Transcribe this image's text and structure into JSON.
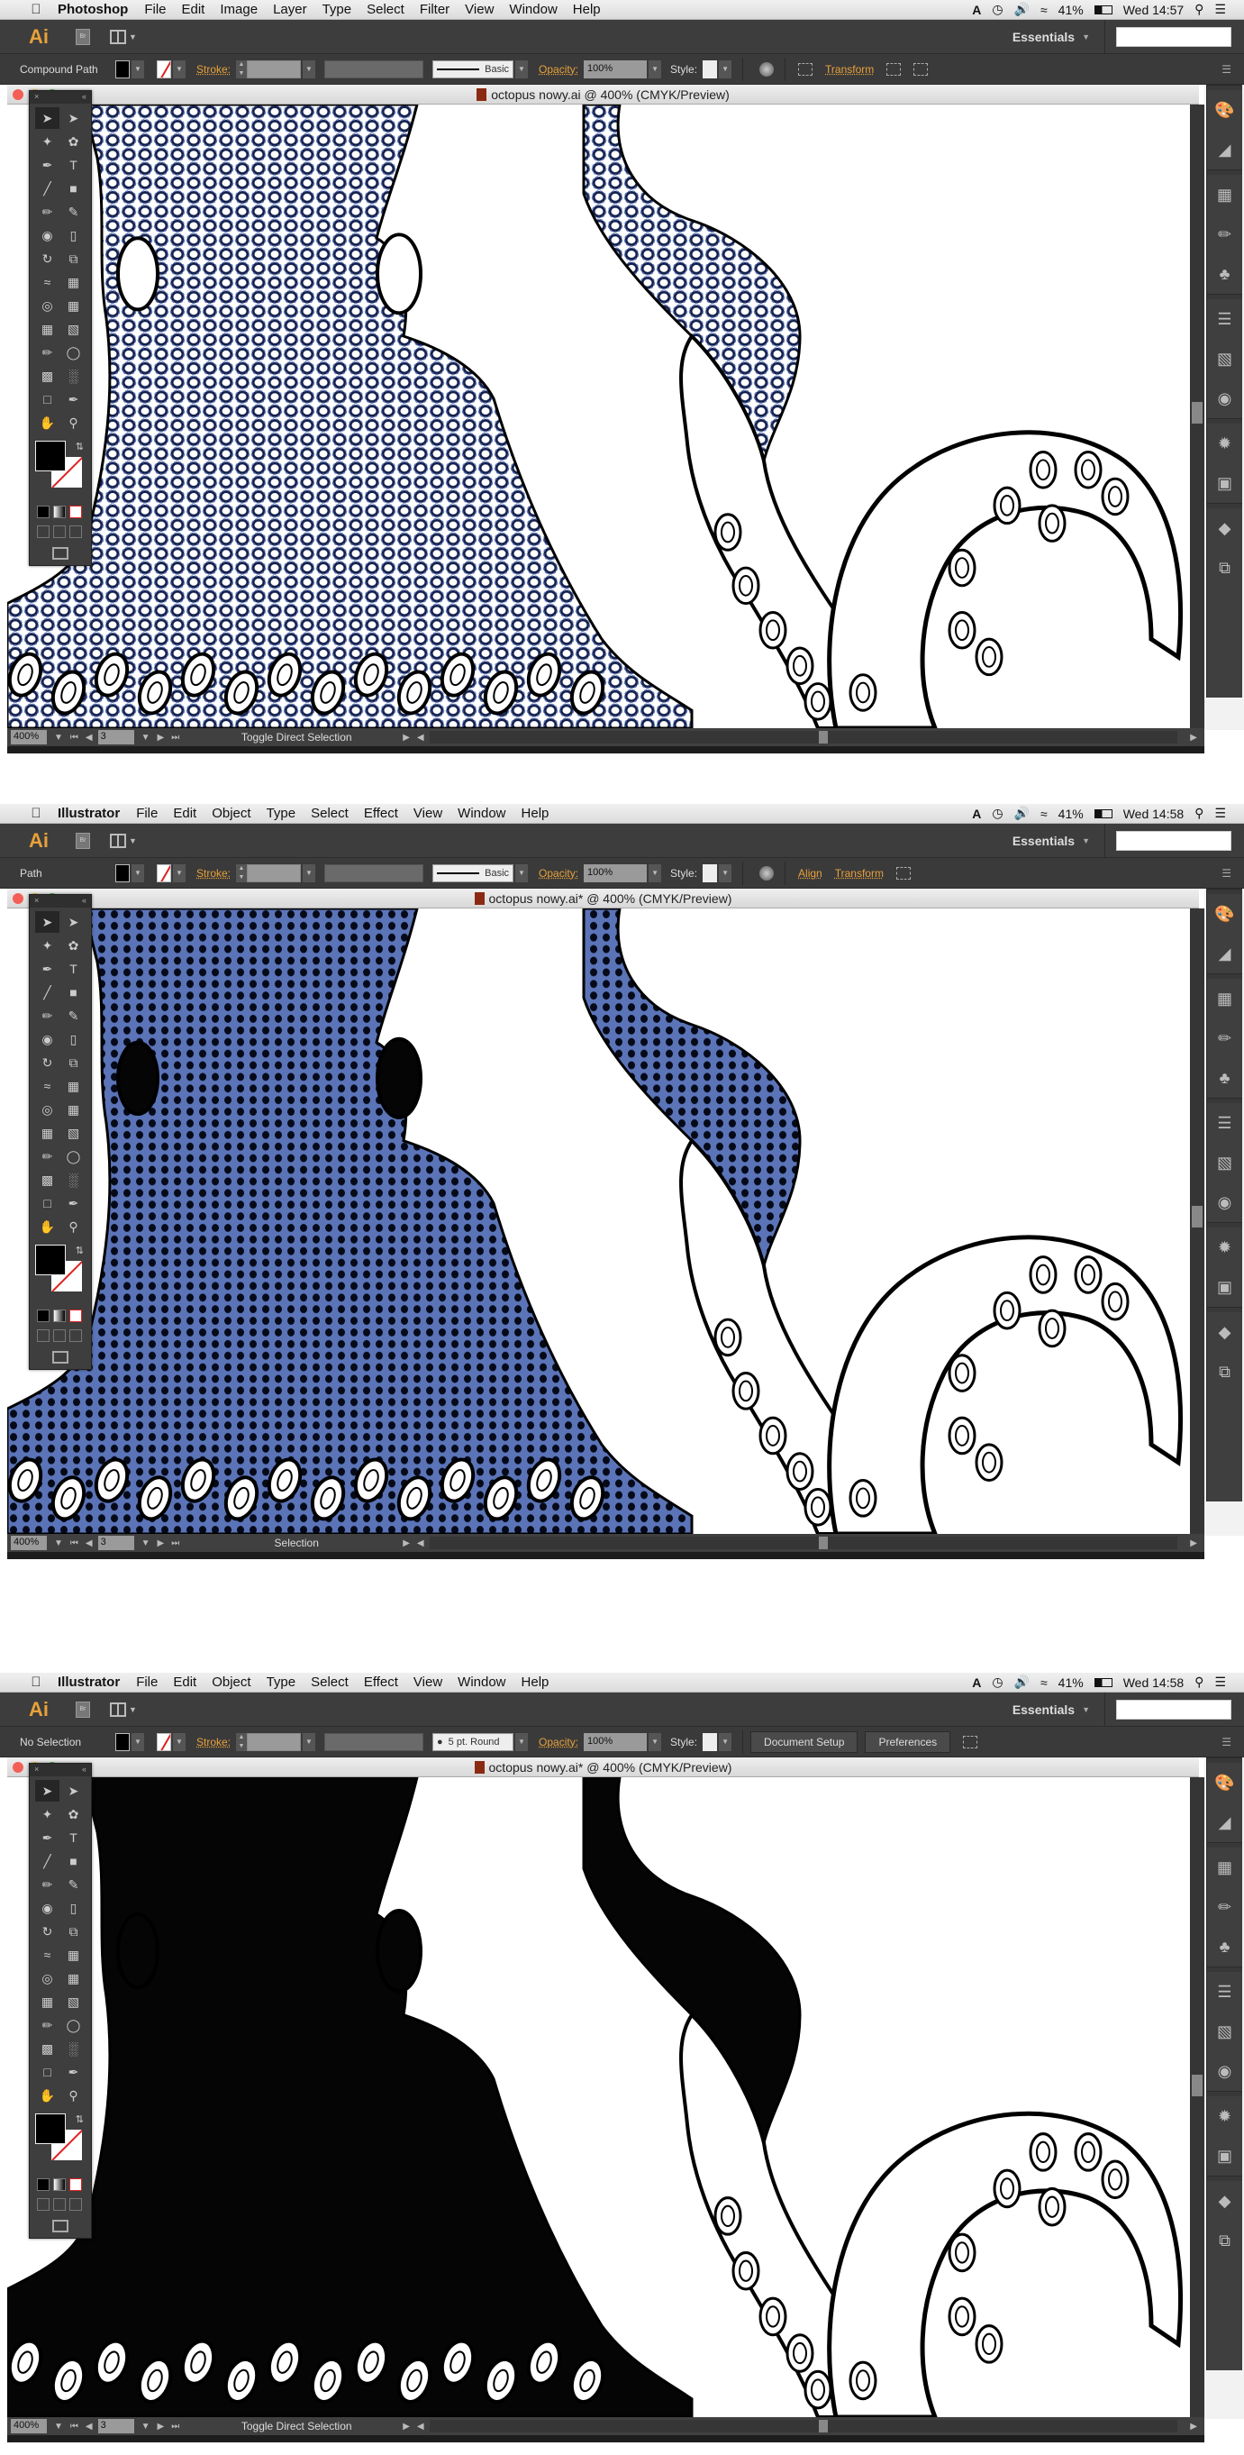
{
  "screenshots": [
    {
      "menubar": {
        "app_name": "Photoshop",
        "items": [
          "File",
          "Edit",
          "Image",
          "Layer",
          "Type",
          "Select",
          "Filter",
          "View",
          "Window",
          "Help"
        ],
        "battery": "41%",
        "clock": "Wed 14:57"
      },
      "appbar": {
        "logo": "Ai",
        "bridge": "Br",
        "workspace": "Essentials",
        "search_value": ""
      },
      "control": {
        "selection_label": "Compound Path",
        "stroke_label": "Stroke:",
        "brush_label": "Basic",
        "opacity_label": "Opacity:",
        "opacity_value": "100%",
        "style_label": "Style:",
        "transform_label": "Transform"
      },
      "document": {
        "title": "octopus nowy.ai @ 400% (CMYK/Preview)"
      },
      "status": {
        "zoom": "400%",
        "page": "3",
        "tool_hint": "Toggle Direct Selection"
      },
      "art_state": "outline-selected"
    },
    {
      "menubar": {
        "app_name": "Illustrator",
        "items": [
          "File",
          "Edit",
          "Object",
          "Type",
          "Select",
          "Effect",
          "View",
          "Window",
          "Help"
        ],
        "battery": "41%",
        "clock": "Wed 14:58"
      },
      "appbar": {
        "logo": "Ai",
        "bridge": "Br",
        "workspace": "Essentials",
        "search_value": ""
      },
      "control": {
        "selection_label": "Path",
        "stroke_label": "Stroke:",
        "brush_label": "Basic",
        "opacity_label": "Opacity:",
        "opacity_value": "100%",
        "style_label": "Style:",
        "align_label": "Align",
        "transform_label": "Transform"
      },
      "document": {
        "title": "octopus nowy.ai* @ 400% (CMYK/Preview)"
      },
      "status": {
        "zoom": "400%",
        "page": "3",
        "tool_hint": "Selection"
      },
      "art_state": "filled-selected"
    },
    {
      "menubar": {
        "app_name": "Illustrator",
        "items": [
          "File",
          "Edit",
          "Object",
          "Type",
          "Select",
          "Effect",
          "View",
          "Window",
          "Help"
        ],
        "battery": "41%",
        "clock": "Wed 14:58"
      },
      "appbar": {
        "logo": "Ai",
        "bridge": "Br",
        "workspace": "Essentials",
        "search_value": ""
      },
      "control": {
        "selection_label": "No Selection",
        "stroke_label": "Stroke:",
        "brush_label": "5 pt. Round",
        "opacity_label": "Opacity:",
        "opacity_value": "100%",
        "style_label": "Style:",
        "document_setup_label": "Document Setup",
        "preferences_label": "Preferences"
      },
      "document": {
        "title": "octopus nowy.ai* @ 400% (CMYK/Preview)"
      },
      "status": {
        "zoom": "400%",
        "page": "3",
        "tool_hint": "Toggle Direct Selection"
      },
      "art_state": "filled-black"
    }
  ],
  "colors": {
    "accent_orange": "#e8a13a",
    "selection_blue": "#5b74b8",
    "ui_dark": "#3d3d3d"
  },
  "icons": {
    "apple": "",
    "toolbox": [
      "selection-tool",
      "direct-selection-tool",
      "magic-wand-tool",
      "lasso-tool",
      "pen-tool",
      "type-tool",
      "line-tool",
      "rectangle-tool",
      "paintbrush-tool",
      "pencil-tool",
      "blob-brush-tool",
      "eraser-tool",
      "rotate-tool",
      "scale-tool",
      "warp-tool",
      "free-transform-tool",
      "shape-builder-tool",
      "perspective-grid-tool",
      "mesh-tool",
      "gradient-tool",
      "eyedropper-tool",
      "blend-tool",
      "symbol-sprayer-tool",
      "graph-tool",
      "artboard-tool",
      "slice-tool",
      "hand-tool",
      "zoom-tool"
    ],
    "dock": [
      "color-icon",
      "color-guide-icon",
      "swatches-icon",
      "brushes-icon",
      "symbols-icon",
      "stroke-icon",
      "gradient-icon",
      "transparency-icon",
      "appearance-icon",
      "graphic-styles-icon",
      "layers-icon",
      "artboards-icon"
    ]
  }
}
